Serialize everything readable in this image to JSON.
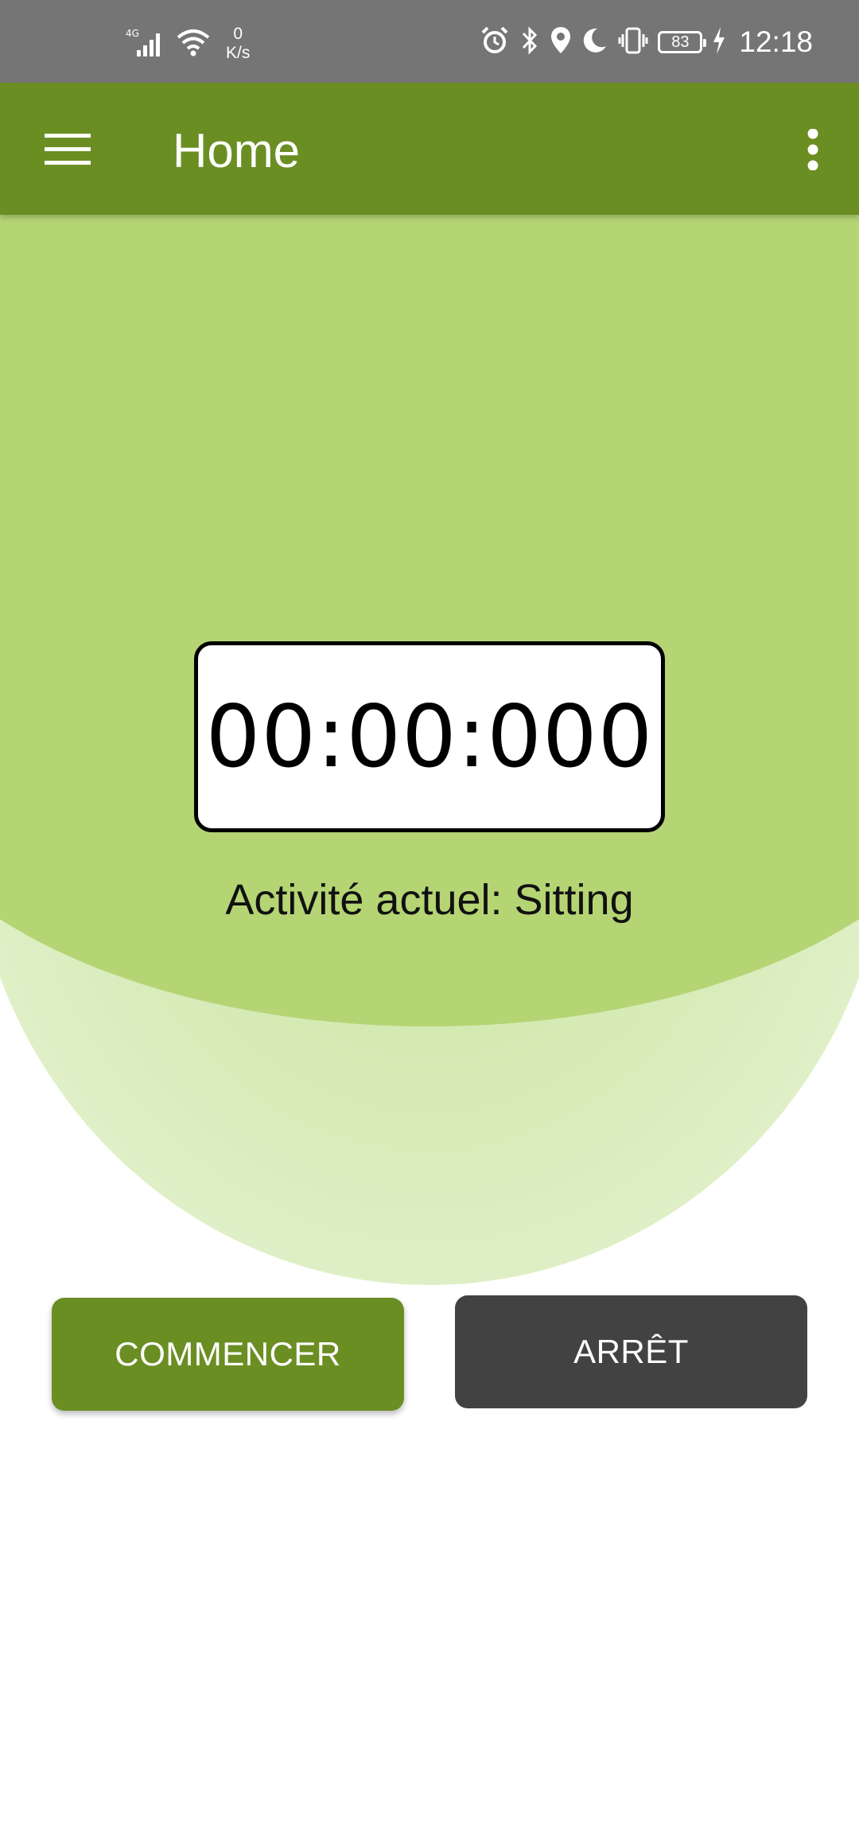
{
  "status_bar": {
    "network_type": "4G",
    "net_speed_value": "0",
    "net_speed_unit": "K/s",
    "battery_level": "83",
    "time": "12:18",
    "icons": [
      "signal-icon",
      "wifi-icon",
      "alarm-icon",
      "bluetooth-icon",
      "location-icon",
      "do-not-disturb-icon",
      "vibrate-icon",
      "battery-icon",
      "charging-icon"
    ]
  },
  "app_bar": {
    "title": "Home",
    "background_color": "#6b8e23",
    "icons": [
      "menu-icon",
      "more-vert-icon"
    ]
  },
  "timer": {
    "value": "00:00:000"
  },
  "activity": {
    "label": "Activité actuel: Sitting"
  },
  "buttons": {
    "start_label": "COMMENCER",
    "stop_label": "ARRÊT",
    "start_color": "#6b8e23",
    "stop_color": "#424242"
  },
  "colors": {
    "background_blob": "#b5d474",
    "status_bar": "#757575"
  }
}
